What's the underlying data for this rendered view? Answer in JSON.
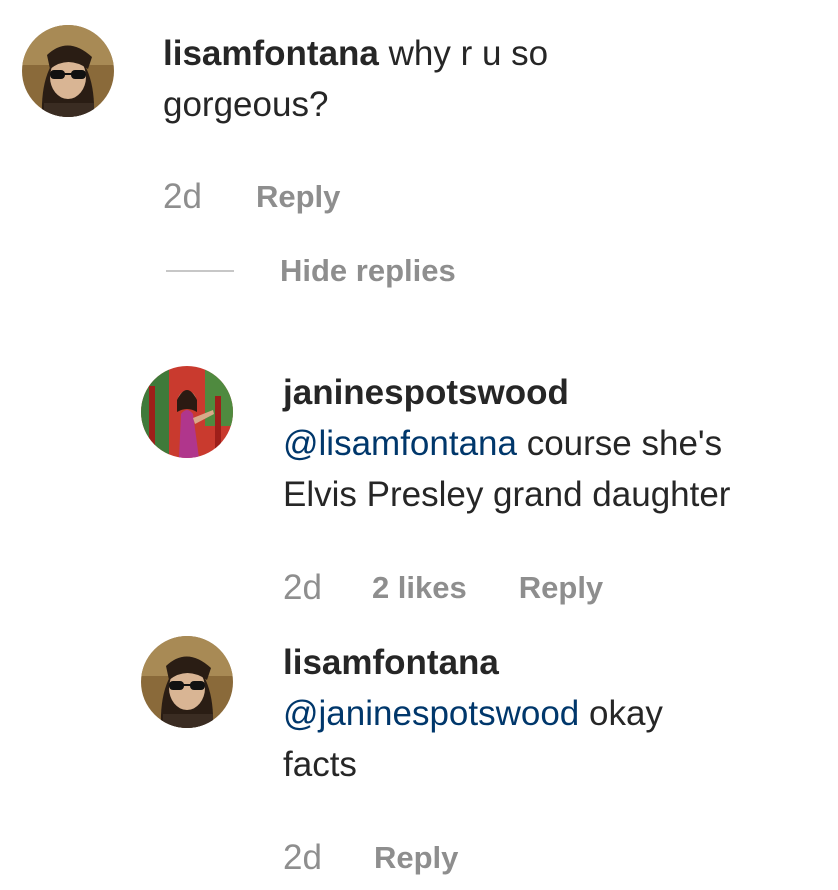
{
  "comments": [
    {
      "username": "lisamfontana",
      "text_line1": " why r u so",
      "text_line2": "gorgeous?",
      "time": "2d",
      "reply_label": "Reply",
      "hide_replies_label": "Hide replies"
    }
  ],
  "replies": [
    {
      "username": "janinespotswood",
      "mention": "@lisamfontana",
      "text_line1_rest": " course she's",
      "text_line2": "Elvis Presley grand daughter",
      "time": "2d",
      "likes": "2 likes",
      "reply_label": "Reply"
    },
    {
      "username": "lisamfontana",
      "mention": "@janinespotswood",
      "text_line1_rest": " okay",
      "text_line2": "facts",
      "time": "2d",
      "reply_label": "Reply"
    }
  ],
  "colors": {
    "text": "#262626",
    "secondary": "#8e8e8e",
    "mention": "#00376b",
    "divider": "#c7c7c7"
  }
}
